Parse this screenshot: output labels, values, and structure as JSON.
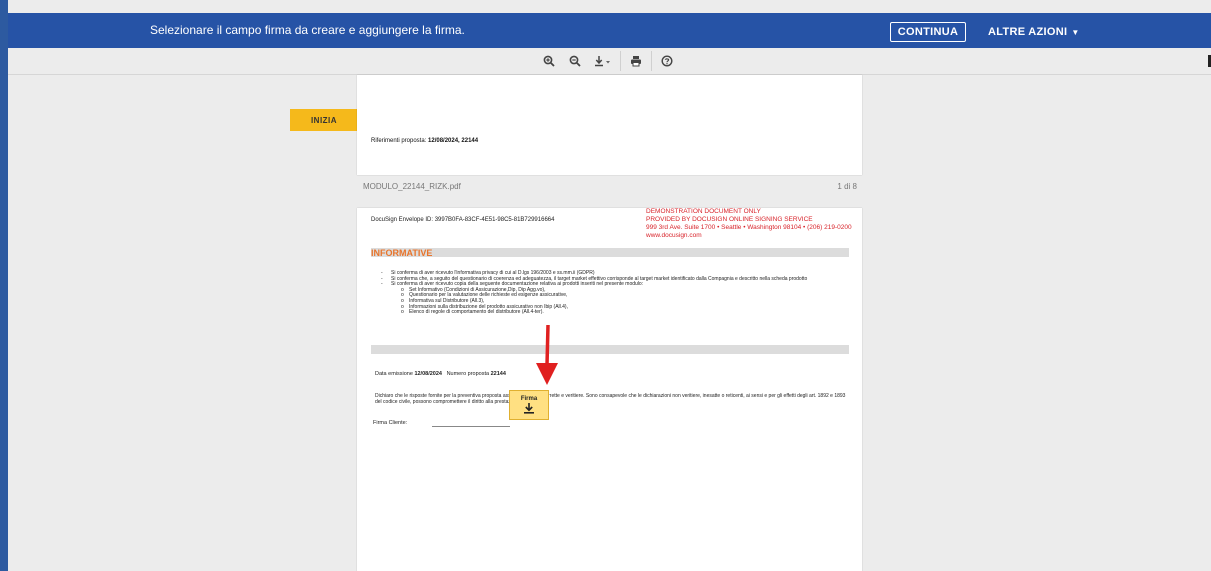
{
  "topbar": {
    "message": "Selezionare il campo firma da creare e aggiungere la firma.",
    "continue_label": "CONTINUA",
    "more_actions_label": "ALTRE AZIONI",
    "more_actions_caret": "▼"
  },
  "toolbar": {
    "icons": [
      "zoom-in-icon",
      "zoom-out-icon",
      "download-icon",
      "print-icon",
      "help-icon"
    ]
  },
  "start_tab": {
    "label": "INIZIA"
  },
  "page1": {
    "ref_label": "Riferimenti proposta: ",
    "ref_value": "12/08/2024, 22144"
  },
  "file": {
    "name": "MODULO_22144_RIZK.pdf",
    "page_indicator": "1 di 8"
  },
  "page2": {
    "envelope_id": "DocuSign Envelope ID: 3997B0FA-83CF-4E51-98C5-81B729916664",
    "demo_lines": [
      "DEMONSTRATION DOCUMENT ONLY",
      "PROVIDED BY DOCUSIGN ONLINE SIGNING SERVICE",
      "999 3rd Ave. Suite 1700  •  Seattle • Washington 98104 • (206) 219-0200",
      "www.docusign.com"
    ],
    "section_title": "INFORMATIVE",
    "bullets": [
      "Si conferma di aver ricevuto l'informativa privacy di cui al D.lgs 196/2003 e ss.mm.ii (GDPR)",
      "Si conferma che, a seguito del questionario di coerenza ed adeguatezza, il target market effettivo corrisponde al target market identificato dalla Compagnia e descritto nella scheda prodotto",
      "Si conferma di aver ricevuto copia della seguente documentazione relativa ai prodotti inseriti nel presente modulo:"
    ],
    "sub_bullets": [
      "Set Informativo (Condizioni di Assicurazione,Dip, Dip Agg.vo),",
      "Questionario per la valutazione delle richieste ed esigenze assicurative,",
      "Informativa sul Distributore (All.3),",
      "Informazioni sulla distribuzione del prodotto assicurativo non Ibip (All.4),",
      "Elenco di regole di comportamento del distributore (All.4-ter)."
    ],
    "emission_label": "Data emissione ",
    "emission_date": "12/08/2024",
    "proposal_label": "Numero proposta ",
    "proposal_number": "22144",
    "declaration": "Dichiaro che le risposte fornite per la preventiva proposta assicurativa sono corrette e veritiere. Sono consapevole che le dichiarazioni non veritiere, inesatte o reticenti, ai sensi e per gli effetti degli art. 1892 e 1893 del codice civile, possono compromettere il diritto alla prestazione.",
    "signer_label": "Firma Cliente:"
  },
  "sign_field": {
    "label": "Firma"
  },
  "colors": {
    "topbar": "#2653a6",
    "start_tab": "#f5b91b",
    "sign_field": "#ffe082",
    "demo_text": "#d8232a",
    "section_title": "#e8742b",
    "arrow": "#e02020"
  }
}
